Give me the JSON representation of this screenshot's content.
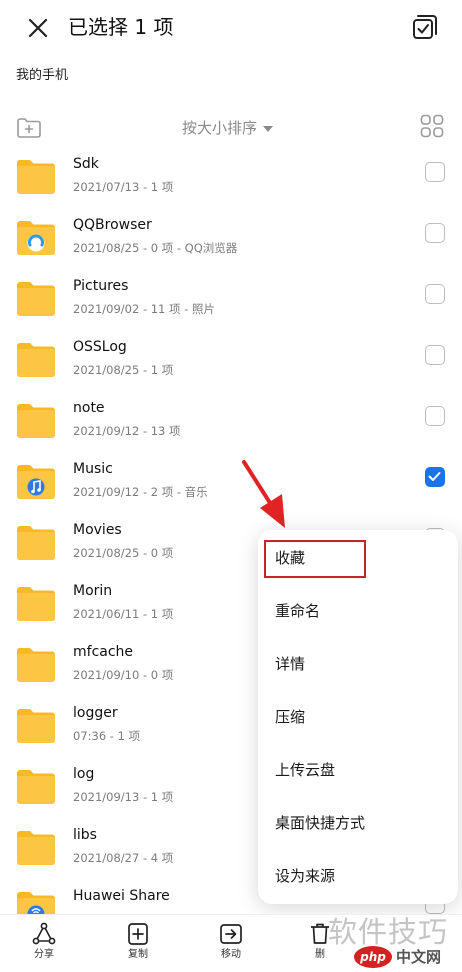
{
  "header": {
    "title": "已选择 1 项",
    "close_icon": "close-icon",
    "select_all_icon": "select-all-icon"
  },
  "breadcrumb": "我的手机",
  "toolbar": {
    "sort_label": "按大小排序",
    "new_folder_icon": "new-folder-icon",
    "grid_icon": "grid-view-icon"
  },
  "colors": {
    "folder": "#fcc644",
    "folder_tab": "#f9b826",
    "accent": "#1a73e8",
    "highlight": "#c6242b",
    "arrow": "#e02424"
  },
  "files": [
    {
      "name": "Sdk",
      "meta": "2021/07/13 - 1 项",
      "icon": "folder-icon",
      "checked": false
    },
    {
      "name": "QQBrowser",
      "meta": "2021/08/25 - 0 项 - QQ浏览器",
      "icon": "qqbrowser-folder-icon",
      "checked": false
    },
    {
      "name": "Pictures",
      "meta": "2021/09/02 - 11 项 - 照片",
      "icon": "folder-icon",
      "checked": false
    },
    {
      "name": "OSSLog",
      "meta": "2021/08/25 - 1 项",
      "icon": "folder-icon",
      "checked": false
    },
    {
      "name": "note",
      "meta": "2021/09/12 - 13 项",
      "icon": "folder-icon",
      "checked": false
    },
    {
      "name": "Music",
      "meta": "2021/09/12 - 2 项 - 音乐",
      "icon": "music-folder-icon",
      "checked": true
    },
    {
      "name": "Movies",
      "meta": "2021/08/25 - 0 项",
      "icon": "folder-icon",
      "checked": false
    },
    {
      "name": "Morin",
      "meta": "2021/06/11 - 1 项",
      "icon": "folder-icon",
      "checked": false
    },
    {
      "name": "mfcache",
      "meta": "2021/09/10 - 0 项",
      "icon": "folder-icon",
      "checked": false
    },
    {
      "name": "logger",
      "meta": "07:36 - 1 项",
      "icon": "folder-icon",
      "checked": false
    },
    {
      "name": "log",
      "meta": "2021/09/13 - 1 项",
      "icon": "folder-icon",
      "checked": false
    },
    {
      "name": "libs",
      "meta": "2021/08/27 - 4 项",
      "icon": "folder-icon",
      "checked": false
    },
    {
      "name": "Huawei Share",
      "meta": "",
      "icon": "huawei-share-folder-icon",
      "checked": false
    }
  ],
  "context_menu": {
    "items": [
      "收藏",
      "重命名",
      "详情",
      "压缩",
      "上传云盘",
      "桌面快捷方式",
      "设为来源"
    ],
    "highlighted_item": "收藏"
  },
  "bottom_bar": {
    "items": [
      {
        "label": "分享",
        "icon": "share-icon"
      },
      {
        "label": "复制",
        "icon": "copy-icon"
      },
      {
        "label": "移动",
        "icon": "move-icon"
      },
      {
        "label": "删",
        "icon": "delete-icon"
      }
    ]
  },
  "watermark": {
    "text": "软件技巧",
    "logo": "php",
    "site": "中文网"
  }
}
